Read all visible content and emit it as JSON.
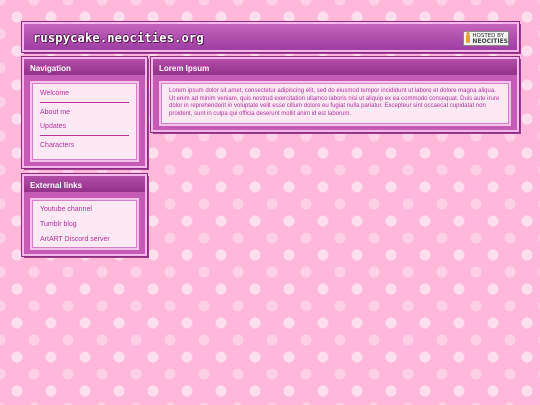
{
  "header": {
    "site_title": "ruspycake.neocities.org",
    "badge_top": "HOSTED BY",
    "badge_brand": "NEOCITIES"
  },
  "navigation": {
    "title": "Navigation",
    "items": [
      {
        "label": "Welcome"
      },
      {
        "label": "About me"
      },
      {
        "label": "Updates"
      },
      {
        "label": "Characters"
      }
    ]
  },
  "external_links": {
    "title": "External links",
    "items": [
      {
        "label": "Youtube channel"
      },
      {
        "label": "Tumblr blog"
      },
      {
        "label": "ArtART Discord server"
      }
    ]
  },
  "main": {
    "title": "Lorem Ipsum",
    "body": "Lorem ipsum dolor sit amet, consectetur adipiscing elit, sed do eiusmod tempor incididunt ut labore et dolore magna aliqua. Ut enim ad minim veniam, quis nostrud exercitation ullamco laboris nisi ut aliquip ex ea commodo consequat. Duis aute irure dolor in reprehenderit in voluptate velit esse cillum dolore eu fugiat nulla pariatur. Excepteur sint occaecat cupidatat non proident, sunt in culpa qui officia deserunt mollit anim id est laborum."
  },
  "colors": {
    "background_pink": "#ffb8d9",
    "panel_purple": "#c45bb4",
    "link_color": "#b3339e",
    "inner_bg": "#fde9f4"
  },
  "icons": [
    "neocities-cat-icon",
    "heart-pattern"
  ]
}
